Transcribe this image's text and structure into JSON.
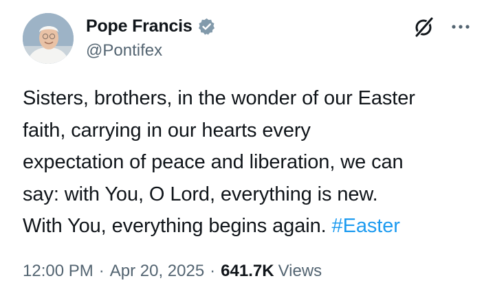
{
  "author": {
    "name": "Pope Francis",
    "handle": "@Pontifex",
    "verified": true,
    "badge_color": "#829aab"
  },
  "header_icons": {
    "grok": "grok-icon",
    "more": "more-options-icon"
  },
  "tweet": {
    "lines": [
      "Sisters, brothers, in the wonder of our Easter",
      "faith, carrying in our hearts every",
      "expectation of peace and liberation, we can",
      "say: with You, O Lord, everything is new.",
      "With You, everything begins again."
    ],
    "hashtag": "#Easter",
    "hashtag_color": "#1d9bf0"
  },
  "meta": {
    "time": "12:00 PM",
    "separator": "·",
    "date": "Apr 20, 2025",
    "views_count": "641.7K",
    "views_label": "Views"
  }
}
